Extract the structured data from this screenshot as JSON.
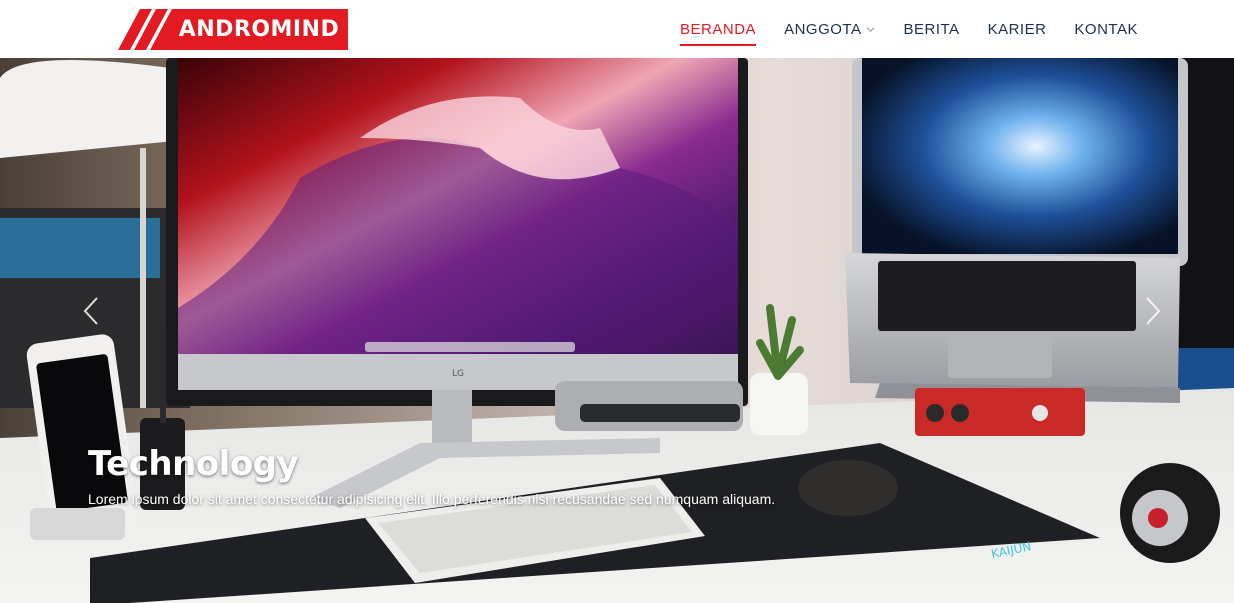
{
  "brand": {
    "name": "ANDROMIND",
    "accent_color": "#e21b23"
  },
  "nav": {
    "items": [
      {
        "label": "BERANDA",
        "active": true
      },
      {
        "label": "ANGGOTA",
        "dropdown": true
      },
      {
        "label": "BERITA"
      },
      {
        "label": "KARIER"
      },
      {
        "label": "KONTAK"
      }
    ]
  },
  "carousel": {
    "prev_icon": "chevron-left-icon",
    "next_icon": "chevron-right-icon",
    "slide": {
      "title": "Technology",
      "text": "Lorem ipsum dolor sit amet consectetur adipisicing elit. Illo perferendis nisi recusandae sed numquam aliquam.",
      "monitor_brand": "LG"
    }
  }
}
